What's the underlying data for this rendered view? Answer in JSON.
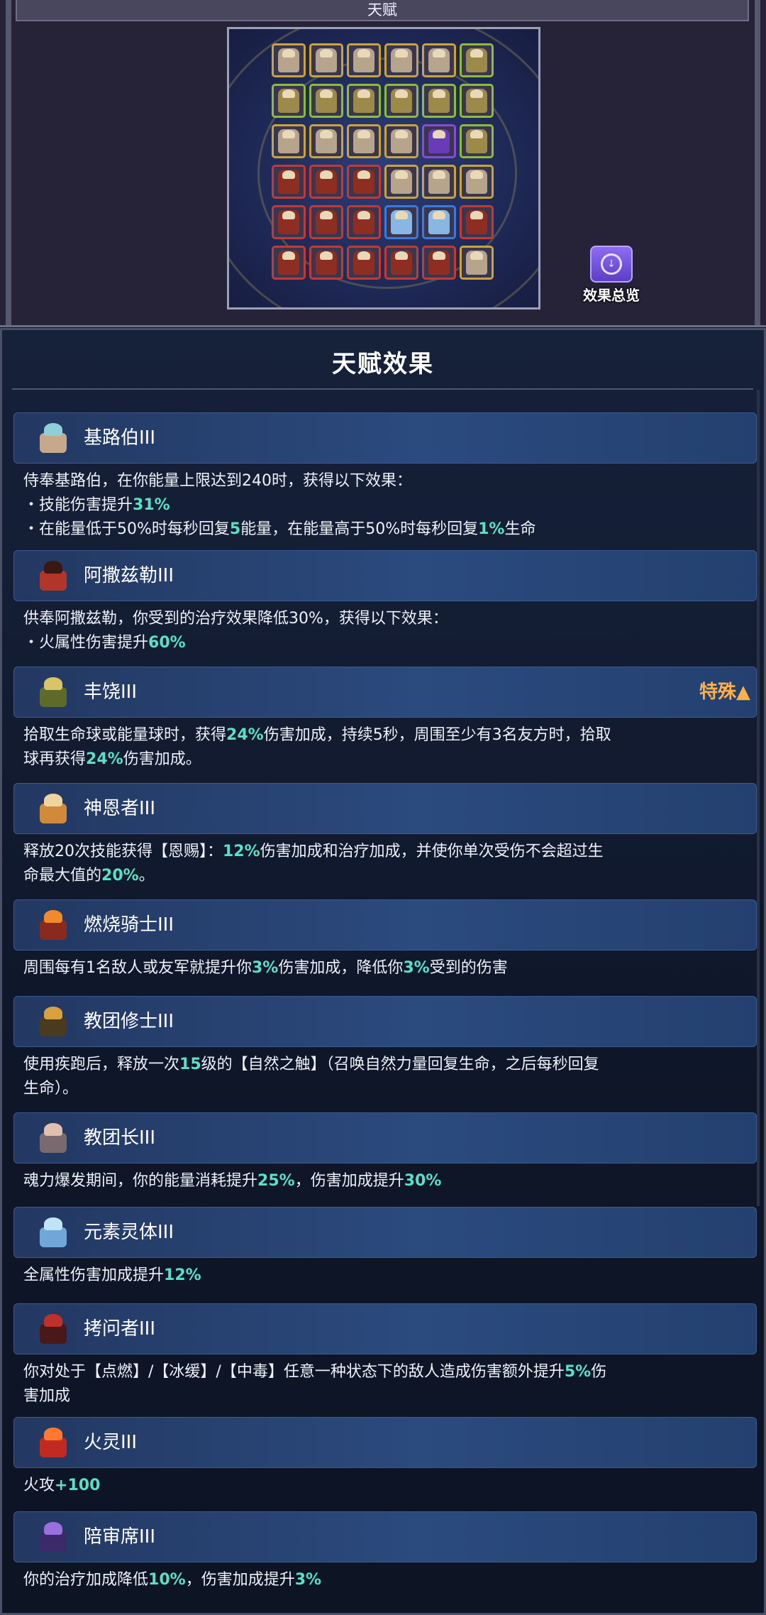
{
  "top_panel": {
    "title": "天赋",
    "overview_label": "效果总览",
    "board_rows": [
      [
        "gold",
        "gold",
        "gold",
        "gold",
        "gold",
        "green"
      ],
      [
        "green",
        "green",
        "green",
        "green",
        "green",
        "green"
      ],
      [
        "gold",
        "gold",
        "gold",
        "gold",
        "purple",
        "green"
      ],
      [
        "red",
        "red",
        "red",
        "gold",
        "gold",
        "gold"
      ],
      [
        "red",
        "red",
        "red",
        "blue",
        "blue",
        "red"
      ],
      [
        "red",
        "red",
        "red",
        "red",
        "red",
        "gold"
      ]
    ],
    "tile_colors": {
      "gold": "#c9a43d",
      "green": "#8dbb3a",
      "purple": "#8a4bd6",
      "red": "#c33a35",
      "blue": "#3d79d8"
    },
    "figure_colors": {
      "gold": "#b7a48c",
      "green": "#9b8a4a",
      "purple": "#6a3bb8",
      "red": "#8e2e22",
      "blue": "#8ab6e3"
    }
  },
  "effects_panel": {
    "title": "天赋效果",
    "highlight_color": "#5ce0c4",
    "special_color": "#ffb04a",
    "effects": [
      {
        "name": "基路伯III",
        "icon": "cherub-icon",
        "icon_colors": [
          "#8fd0d8",
          "#c6a98a"
        ],
        "tag": "",
        "lines": [
          [
            {
              "t": "侍奉基路伯，在你能量上限达到240时，获得以下效果："
            }
          ],
          [
            {
              "t": "・技能伤害提升"
            },
            {
              "t": "31%",
              "hl": true
            }
          ],
          [
            {
              "t": "・在能量低于50%时每秒回复"
            },
            {
              "t": "5",
              "hl": true
            },
            {
              "t": "能量，在能量高于50%时每秒回复"
            },
            {
              "t": "1%",
              "hl": true
            },
            {
              "t": "生命"
            }
          ]
        ]
      },
      {
        "name": "阿撒兹勒III",
        "icon": "azazel-icon",
        "icon_colors": [
          "#3a1812",
          "#b2352a"
        ],
        "tag": "",
        "lines": [
          [
            {
              "t": "供奉阿撒兹勒，你受到的治疗效果降低30%，获得以下效果："
            }
          ],
          [
            {
              "t": "・火属性伤害提升"
            },
            {
              "t": "60%",
              "hl": true
            }
          ]
        ]
      },
      {
        "name": "丰饶III",
        "icon": "abundance-icon",
        "icon_colors": [
          "#d9c468",
          "#5d6b2a"
        ],
        "tag": "特殊▲",
        "lines": [
          [
            {
              "t": "拾取生命球或能量球时，获得"
            },
            {
              "t": "24%",
              "hl": true
            },
            {
              "t": "伤害加成，持续5秒，周围至少有3名友方时，拾取"
            }
          ],
          [
            {
              "t": "球再获得"
            },
            {
              "t": "24%",
              "hl": true
            },
            {
              "t": "伤害加成。"
            }
          ]
        ]
      },
      {
        "name": "神恩者III",
        "icon": "blessed-icon",
        "icon_colors": [
          "#f0d4a0",
          "#d08a3a"
        ],
        "tag": "",
        "lines": [
          [
            {
              "t": "释放20次技能获得【恩赐】："
            },
            {
              "t": "12%",
              "hl": true
            },
            {
              "t": "伤害加成和治疗加成，并使你单次受伤不会超过生"
            }
          ],
          [
            {
              "t": "命最大值的"
            },
            {
              "t": "20%",
              "hl": true
            },
            {
              "t": "。"
            }
          ]
        ]
      },
      {
        "name": "燃烧骑士III",
        "icon": "burning-knight-icon",
        "icon_colors": [
          "#f08a2a",
          "#8a2a1e"
        ],
        "tag": "",
        "lines": [
          [
            {
              "t": "周围每有1名敌人或友军就提升你"
            },
            {
              "t": "3%",
              "hl": true
            },
            {
              "t": "伤害加成，降低你"
            },
            {
              "t": "3%",
              "hl": true
            },
            {
              "t": "受到的伤害"
            }
          ]
        ]
      },
      {
        "name": "教团修士III",
        "icon": "order-monk-icon",
        "icon_colors": [
          "#d9a040",
          "#4a3a20"
        ],
        "tag": "",
        "lines": [
          [
            {
              "t": "使用疾跑后，释放一次"
            },
            {
              "t": "15",
              "hl": true
            },
            {
              "t": "级的【自然之触】（召唤自然力量回复生命，之后每秒回复"
            }
          ],
          [
            {
              "t": "生命）。"
            }
          ]
        ]
      },
      {
        "name": "教团长III",
        "icon": "order-leader-icon",
        "icon_colors": [
          "#e0c0b0",
          "#7a6a70"
        ],
        "tag": "",
        "lines": [
          [
            {
              "t": "魂力爆发期间，你的能量消耗提升"
            },
            {
              "t": "25%",
              "hl": true
            },
            {
              "t": "，伤害加成提升"
            },
            {
              "t": "30%",
              "hl": true
            }
          ]
        ]
      },
      {
        "name": "元素灵体III",
        "icon": "elemental-spirit-icon",
        "icon_colors": [
          "#bfe4f5",
          "#6fa8d8"
        ],
        "tag": "",
        "lines": [
          [
            {
              "t": "全属性伤害加成提升"
            },
            {
              "t": "12%",
              "hl": true
            }
          ]
        ]
      },
      {
        "name": "拷问者III",
        "icon": "inquisitor-icon",
        "icon_colors": [
          "#c0302a",
          "#4a1818"
        ],
        "tag": "",
        "lines": [
          [
            {
              "t": "你对处于【点燃】/【冰缓】/【中毒】任意一种状态下的敌人造成伤害额外提升"
            },
            {
              "t": "5%",
              "hl": true
            },
            {
              "t": "伤"
            }
          ],
          [
            {
              "t": "害加成"
            }
          ]
        ]
      },
      {
        "name": "火灵III",
        "icon": "fire-spirit-icon",
        "icon_colors": [
          "#ff7a30",
          "#c02a20"
        ],
        "tag": "",
        "lines": [
          [
            {
              "t": "火攻"
            },
            {
              "t": "+100",
              "hl": true
            }
          ]
        ]
      },
      {
        "name": "陪审席III",
        "icon": "jury-icon",
        "icon_colors": [
          "#9a70e0",
          "#3a2a6a"
        ],
        "tag": "",
        "lines": [
          [
            {
              "t": "你的治疗加成降低"
            },
            {
              "t": "10%",
              "hl": true
            },
            {
              "t": "，伤害加成提升"
            },
            {
              "t": "3%",
              "hl": true
            }
          ]
        ]
      }
    ]
  }
}
